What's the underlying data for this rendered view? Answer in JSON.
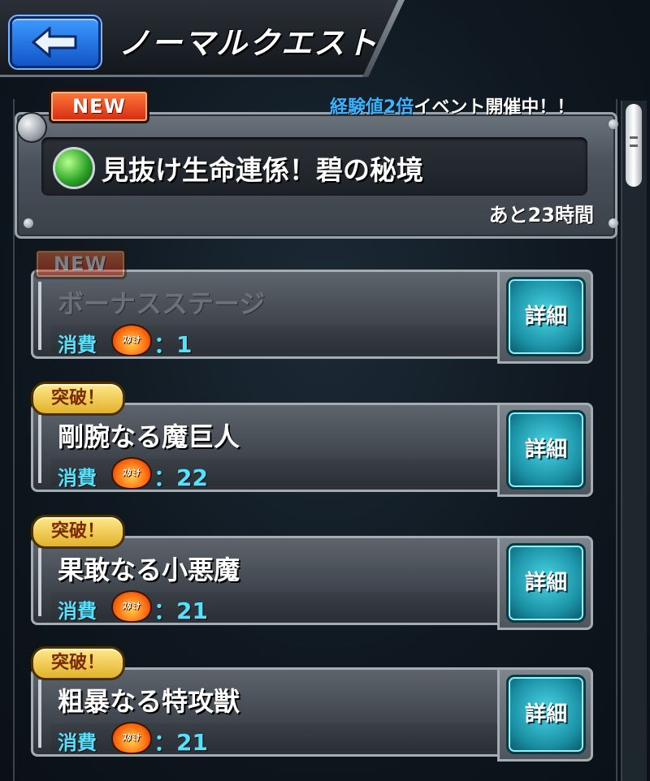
{
  "header": {
    "title": "ノーマルクエスト",
    "back_label": "back"
  },
  "event": {
    "badge": "NEW",
    "note_highlight": "経験値2倍",
    "note_rest": "イベント開催中！！",
    "name": "見抜け生命連係！碧の秘境",
    "remaining": "あと23時間"
  },
  "quests": [
    {
      "badge": "NEW",
      "name": "ボーナスステージ",
      "cost_label": "消費",
      "stamina_label": "ｽﾀﾐﾅ",
      "cost": "：1",
      "detail": "詳細"
    },
    {
      "badge": "突破！",
      "name": "剛腕なる魔巨人",
      "cost_label": "消費",
      "stamina_label": "ｽﾀﾐﾅ",
      "cost": "：22",
      "detail": "詳細"
    },
    {
      "badge": "突破！",
      "name": "果敢なる小悪魔",
      "cost_label": "消費",
      "stamina_label": "ｽﾀﾐﾅ",
      "cost": "：21",
      "detail": "詳細"
    },
    {
      "badge": "突破！",
      "name": "粗暴なる特攻獣",
      "cost_label": "消費",
      "stamina_label": "ｽﾀﾐﾅ",
      "cost": "：21",
      "detail": "詳細"
    }
  ],
  "colors": {
    "accent_cyan": "#56e2ff",
    "note_blue": "#3ab4ff",
    "new_badge": "#e03a18",
    "break_badge": "#f0c63a",
    "detail_button": "#1a8fa3",
    "back_button": "#1e6ee0"
  }
}
